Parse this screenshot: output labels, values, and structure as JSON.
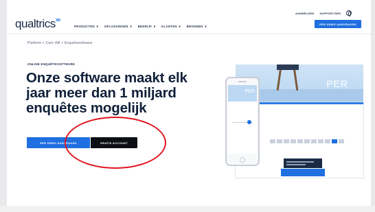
{
  "header": {
    "logo": "qualtrics",
    "logo_mark": "XM",
    "nav": [
      {
        "label": "PRODUCTEN"
      },
      {
        "label": "OPLOSSINGEN"
      },
      {
        "label": "BEDRIJF"
      },
      {
        "label": "KLANTEN"
      },
      {
        "label": "BRONNEN"
      }
    ],
    "chevron": "∨",
    "util_links": [
      "AANMELDEN",
      "SUPPORT/SEN"
    ],
    "cta": "EEN DEMO AANVRAGEN"
  },
  "breadcrumb": "Platform > Core XM > Enquêtesoftware",
  "hero": {
    "eyebrow": "ONLINE ENQUÊTESOFTWARE",
    "headline": "Onze software maakt elk jaar meer dan 1 miljard enquêtes mogelijk",
    "btn_demo": "EEN DEMO AANVRAGEN",
    "btn_trial": "GRATIS ACCOUNT"
  },
  "illustration": {
    "banner_text": "PER",
    "phone_banner_text": "PER"
  },
  "colors": {
    "accent": "#1f6fe0",
    "annotation": "#e0141e",
    "text_dark": "#11203a"
  }
}
